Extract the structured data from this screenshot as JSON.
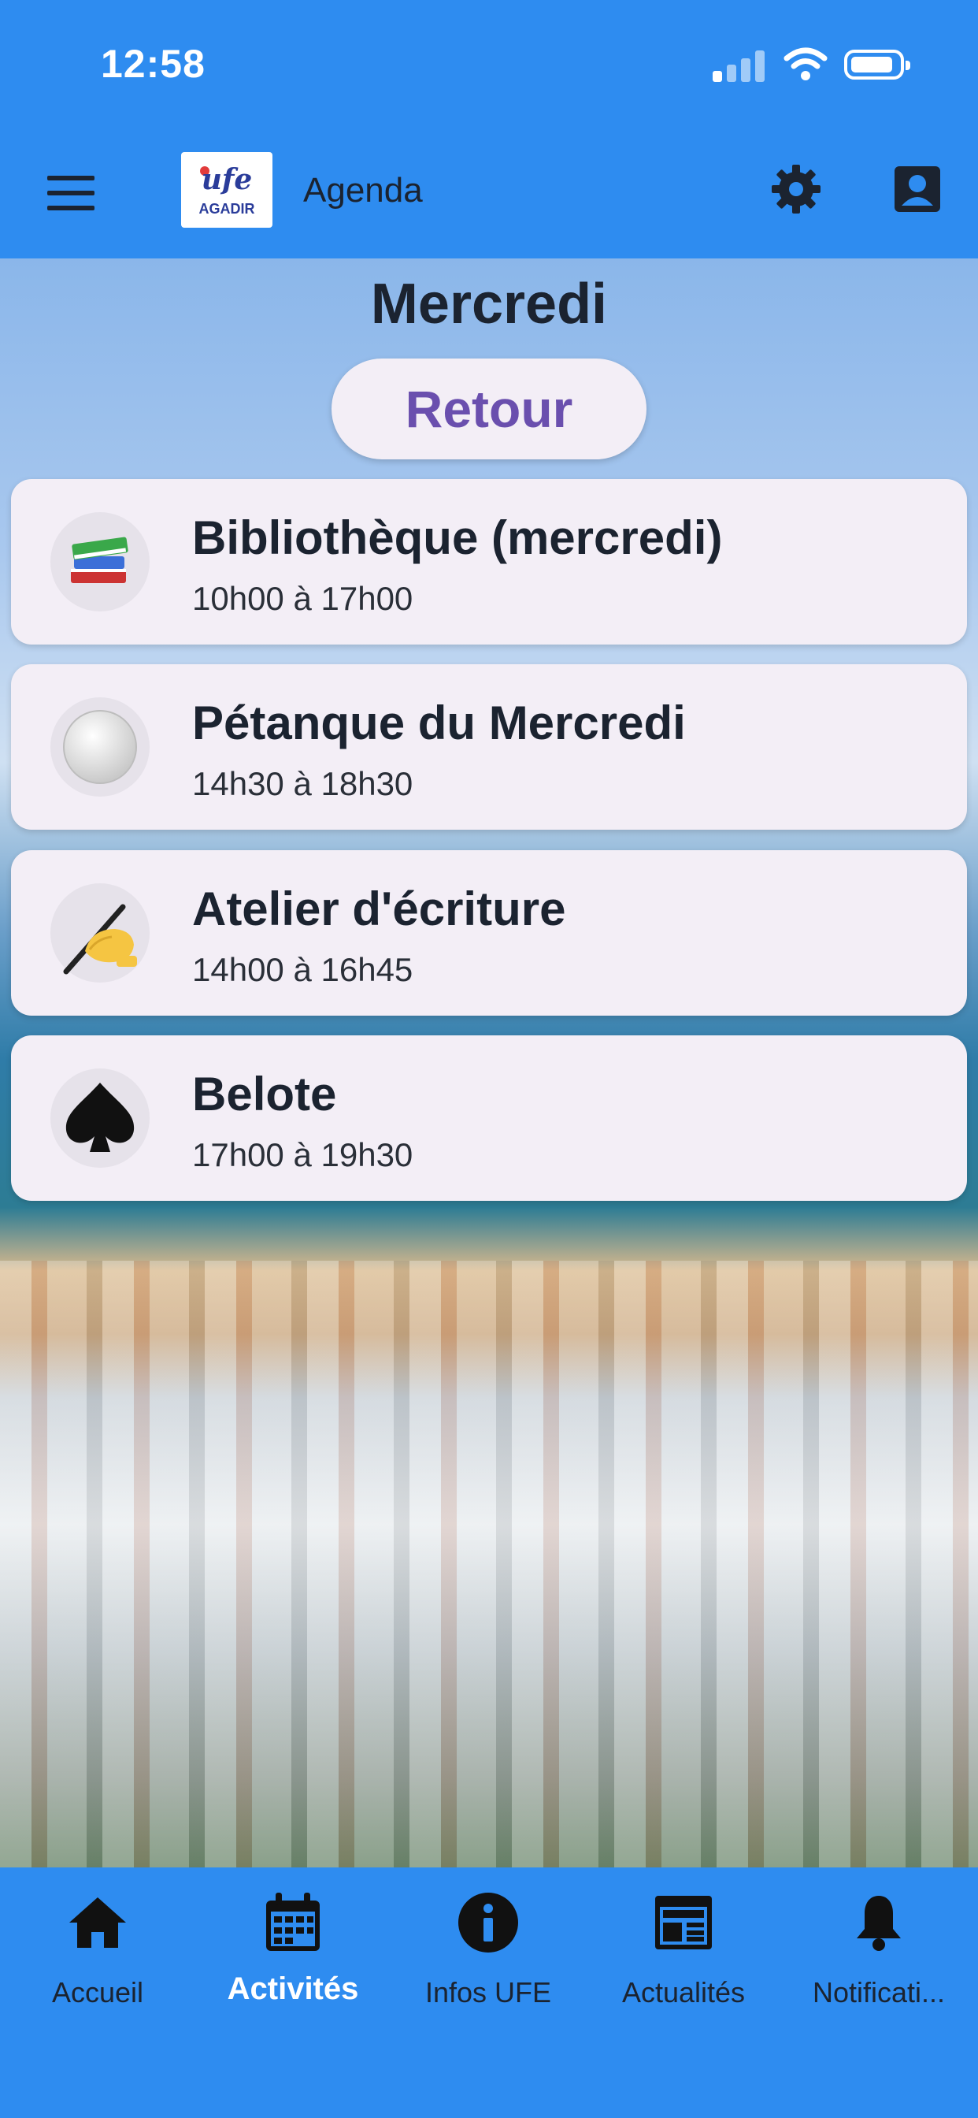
{
  "status_bar": {
    "time": "12:58"
  },
  "header": {
    "title": "Agenda",
    "logo_text": "ufe",
    "logo_subtext": "AGADIR"
  },
  "page": {
    "day_title": "Mercredi",
    "back_button_label": "Retour"
  },
  "activities": [
    {
      "name": "Bibliothèque (mercredi)",
      "hours": "10h00 à 17h00",
      "icon": "books-icon"
    },
    {
      "name": "Pétanque du Mercredi",
      "hours": "14h30 à 18h30",
      "icon": "white-circle-icon"
    },
    {
      "name": "Atelier d'écriture",
      "hours": "14h00 à 16h45",
      "icon": "writing-hand-icon"
    },
    {
      "name": "Belote",
      "hours": "17h00 à 19h30",
      "icon": "spade-icon"
    }
  ],
  "tabs": [
    {
      "label": "Accueil",
      "icon": "home-icon"
    },
    {
      "label": "Activités",
      "icon": "calendar-icon",
      "active": true
    },
    {
      "label": "Infos UFE",
      "icon": "info-icon"
    },
    {
      "label": "Actualités",
      "icon": "newspaper-icon"
    },
    {
      "label": "Notificati...",
      "icon": "bell-icon"
    }
  ],
  "colors": {
    "bar_blue": "#2e8cf0",
    "card_bg": "#f3eef6",
    "accent_purple": "#6a4fae",
    "dark_text": "#1b2330"
  }
}
